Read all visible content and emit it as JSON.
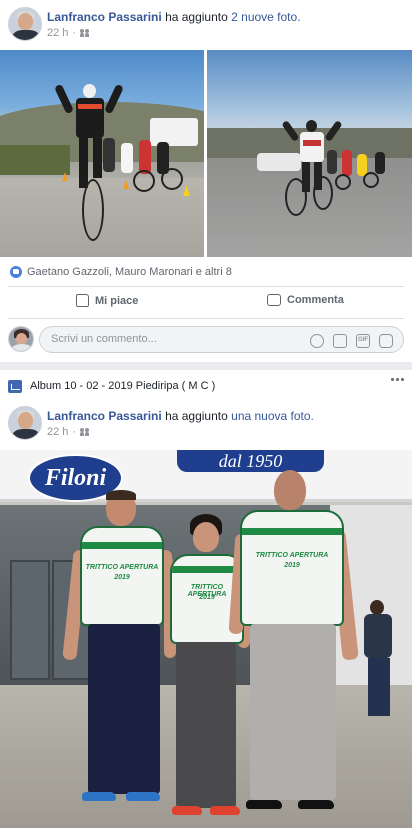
{
  "post1": {
    "author": "Lanfranco Passarini",
    "verb": "ha aggiunto",
    "object": "2 nuove foto.",
    "time": "22 h",
    "audience_icon": "friends-icon",
    "likes_text": "Gaetano Gazzoli, Mauro Maronari e altri 8",
    "like_label": "Mi piace",
    "comment_label": "Commenta",
    "comment_placeholder": "Scrivi un commento...",
    "comment_icons": [
      "emoji-icon",
      "camera-icon",
      "gif-icon",
      "sticker-icon"
    ],
    "gif_label": "GIF"
  },
  "post2": {
    "album_title": "Album 10 - 02 - 2019 Piediripa ( M C )",
    "author": "Lanfranco Passarini",
    "verb": "ha aggiunto",
    "object": "una nuova foto.",
    "time": "22 h",
    "photo": {
      "brand_sign": "Filoni",
      "since_sign": "dal 1950",
      "jersey_text": "TRITTICO APERTURA",
      "jersey_year": "2019"
    }
  },
  "colors": {
    "link": "#385898",
    "brand_blue": "#1f3f8e",
    "jersey_green": "#1e8a44",
    "like_blue": "#4a7fe0"
  }
}
